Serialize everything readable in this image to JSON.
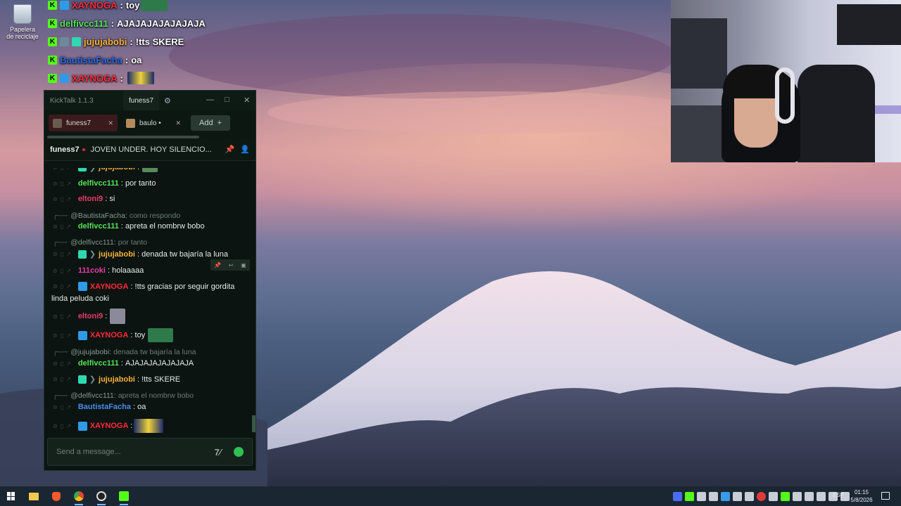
{
  "desktop": {
    "recycle_bin_label": "Papelera de reciclaje"
  },
  "overlay_chat": [
    {
      "user": "XAYNOGA",
      "sep": ":",
      "text": "toy",
      "user_color": "#ff2a3c",
      "emote": true
    },
    {
      "user": "delfivcc111",
      "sep": ":",
      "text": "AJAJAJAJAJAJAJA",
      "user_color": "#57e35a",
      "emote": false
    },
    {
      "user": "jujujabobi",
      "sep": ":",
      "text": "!tts SKERE",
      "user_color": "#f6b23a",
      "emote": false
    },
    {
      "user": "BautistaFacha",
      "sep": ":",
      "text": "oa",
      "user_color": "#2c6ae8",
      "emote": false
    },
    {
      "user": "XAYNOGA",
      "sep": ":",
      "text": "",
      "user_color": "#ff2a3c",
      "emote": true
    }
  ],
  "kicktalk": {
    "app_title": "KickTalk 1.1.3",
    "active_tab_title": "funess7",
    "window_controls": {
      "minimize": "—",
      "maximize": "□",
      "close": "✕"
    },
    "tabs": [
      {
        "label": "funess7",
        "close": "✕"
      },
      {
        "label": "baulo •",
        "close": "✕"
      }
    ],
    "add_button": "Add",
    "add_plus": "+",
    "stream": {
      "channel": "funess7",
      "title": "JOVEN UNDER. HOY SILENCIO..."
    },
    "messages": [
      {
        "kind": "msg",
        "user": "jujujabobi",
        "color": "#f6b23a",
        "text": "",
        "badge": "gg",
        "emote": true
      },
      {
        "kind": "msg",
        "user": "delfivcc111",
        "color": "#57e35a",
        "text": "por tanto"
      },
      {
        "kind": "msg",
        "user": "eltoni9",
        "color": "#e83c6a",
        "text": "si"
      },
      {
        "kind": "reply",
        "text": "@BautistaFacha:",
        "rest": "como respondo"
      },
      {
        "kind": "msg",
        "user": "delfivcc111",
        "color": "#57e35a",
        "text": "apreta el nombrw bobo"
      },
      {
        "kind": "reply",
        "text": "@delfivcc111:",
        "rest": "por tanto"
      },
      {
        "kind": "msg",
        "user": "jujujabobi",
        "color": "#f6b23a",
        "text": "denada tw bajaría la luna",
        "badge": "gg"
      },
      {
        "kind": "msg",
        "user": "111coki",
        "color": "#e83ca8",
        "text": "holaaaaa"
      },
      {
        "kind": "msg",
        "user": "XAYNOGA",
        "color": "#ff2a3c",
        "text": "!tts gracias por seguir gordita",
        "badge": "x",
        "cont": "linda peluda coki"
      },
      {
        "kind": "msg",
        "user": "eltoni9",
        "color": "#e83c6a",
        "text": "",
        "emote": true
      },
      {
        "kind": "msg",
        "user": "XAYNOGA",
        "color": "#ff2a3c",
        "text": "toy",
        "badge": "x",
        "emote": true
      },
      {
        "kind": "reply",
        "text": "@jujujabobi:",
        "rest": "denada tw bajaría la luna"
      },
      {
        "kind": "msg",
        "user": "delfivcc111",
        "color": "#57e35a",
        "text": "AJAJAJAJAJAJAJA"
      },
      {
        "kind": "msg",
        "user": "jujujabobi",
        "color": "#f6b23a",
        "text": "!tts SKERE",
        "badge": "gg"
      },
      {
        "kind": "reply",
        "text": "@delfivcc111:",
        "rest": "apreta el nombrw bobo"
      },
      {
        "kind": "msg",
        "user": "BautistaFacha",
        "color": "#4a8cf0",
        "text": "oa"
      },
      {
        "kind": "msg",
        "user": "XAYNOGA",
        "color": "#ff2a3c",
        "text": "",
        "badge": "x",
        "emote": true
      }
    ],
    "input_placeholder": "Send a message..."
  },
  "taskbar": {
    "language": "ESP",
    "time": "01:15",
    "date": "5/8/2026"
  }
}
